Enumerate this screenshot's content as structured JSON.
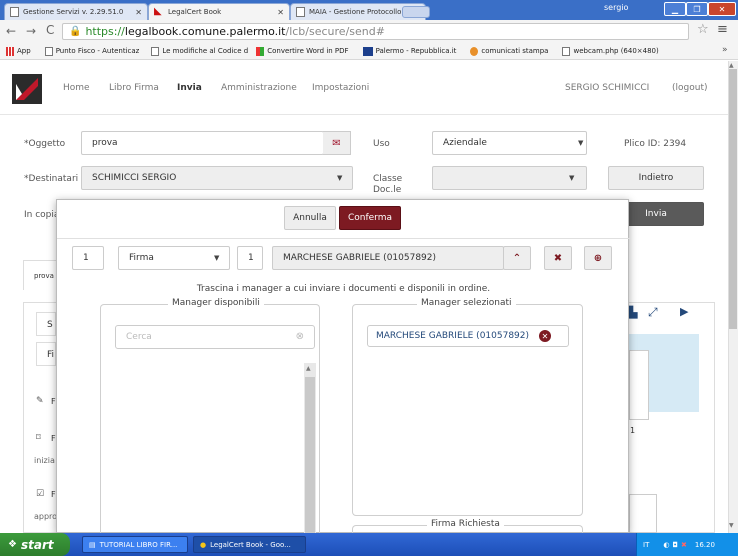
{
  "browser": {
    "tabs": [
      {
        "title": "Gestione Servizi v. 2.29.51.0",
        "active": false
      },
      {
        "title": "LegalCert Book",
        "active": true
      },
      {
        "title": "MAIA - Gestione Protocollo In",
        "active": false
      }
    ],
    "window_user": "sergio",
    "url_scheme": "https://",
    "url_host": "legalbook.comune.palermo.it",
    "url_path": "/lcb/secure/send#",
    "bookmarks": [
      "App",
      "Punto Fisco - Autenticaz",
      "Le modifiche al Codice d",
      "Convertire Word in PDF",
      "Palermo - Repubblica.it",
      "comunicati stampa",
      "webcam.php (640×480)"
    ],
    "bookmarks_more": "»"
  },
  "header": {
    "nav": [
      "Home",
      "Libro Firma",
      "Invia",
      "Amministrazione",
      "Impostazioni"
    ],
    "active_nav": "Invia",
    "user_name": "SERGIO SCHIMICCI",
    "logout_label": "(logout)"
  },
  "form": {
    "oggetto_label": "*Oggetto",
    "oggetto_value": "prova",
    "uso_label": "Uso",
    "uso_value": "Aziendale",
    "plico_label": "Plico ID: 2394",
    "destinatari_label": "*Destinatari",
    "destinatari_value": "SCHIMICCI SERGIO",
    "classe_label": "Classe Doc.le",
    "classe_value": "",
    "indietro_label": "Indietro",
    "incopia_label": "In copia",
    "invia_label": "Invia"
  },
  "background": {
    "tab_label": "prova",
    "left_texts": [
      "S",
      "Fi",
      "F",
      "F",
      "inizia",
      "F",
      "appro"
    ],
    "preview_page_number": "1"
  },
  "modal": {
    "annulla_label": "Annulla",
    "conferma_label": "Conferma",
    "order_value": "1",
    "type_value": "Firma",
    "count_value": "1",
    "manager_value": "MARCHESE GABRIELE (01057892)",
    "instruction": "Trascina i manager a cui inviare i documenti e disponili in ordine.",
    "available_legend": "Manager disponibili",
    "search_placeholder": "Cerca",
    "selected_legend": "Manager selezionati",
    "selected_items": [
      "MARCHESE GABRIELE (01057892)"
    ],
    "firma_legend": "Firma Richiesta"
  },
  "taskbar": {
    "start_label": "start",
    "tasks": [
      "TUTORIAL LIBRO FIR...",
      "LegalCert Book - Goo..."
    ],
    "tray_lang": "IT",
    "clock": "16.20"
  },
  "colors": {
    "accent": "#7d1a22",
    "link_blue": "#24497a",
    "xp_blue": "#245edb"
  }
}
